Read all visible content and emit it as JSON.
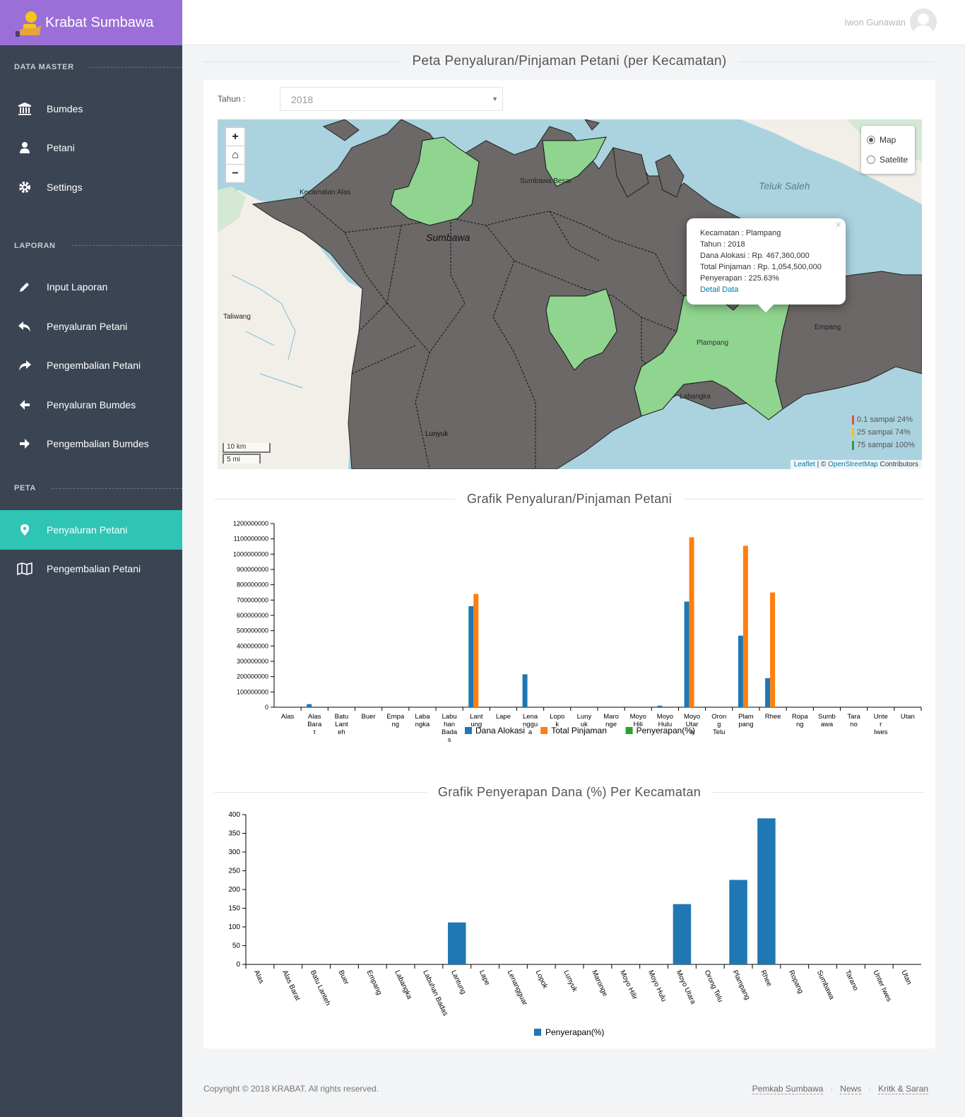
{
  "brand": {
    "title": "Krabat Sumbawa"
  },
  "sidebar": {
    "sections": [
      {
        "title": "DATA MASTER"
      },
      {
        "title": "LAPORAN"
      },
      {
        "title": "PETA"
      }
    ],
    "items": [
      {
        "label": "Bumdes",
        "icon": "bank-icon"
      },
      {
        "label": "Petani",
        "icon": "user-icon"
      },
      {
        "label": "Settings",
        "icon": "gear-icon"
      },
      {
        "label": "Input Laporan",
        "icon": "pencil-icon"
      },
      {
        "label": "Penyaluran Petani",
        "icon": "reply-icon"
      },
      {
        "label": "Pengembalian Petani",
        "icon": "share-icon"
      },
      {
        "label": "Penyaluran Bumdes",
        "icon": "arrow-left-icon"
      },
      {
        "label": "Pengembalian Bumdes",
        "icon": "arrow-right-icon"
      },
      {
        "label": "Penyaluran Petani",
        "icon": "map-marker-icon",
        "active": true
      },
      {
        "label": "Pengembalian Petani",
        "icon": "map-icon"
      }
    ]
  },
  "header": {
    "user_name": "Iwon Gunawan"
  },
  "page": {
    "title": "Peta Penyaluran/Pinjaman Petani (per Kecamatan)",
    "tahun_label": "Tahun :",
    "tahun_value": "2018"
  },
  "map": {
    "zoom_in": "+",
    "home": "⌂",
    "zoom_out": "−",
    "layers": [
      {
        "label": "Map",
        "selected": true
      },
      {
        "label": "Satelite",
        "selected": false
      }
    ],
    "place_labels": [
      "Kecamatan Alas",
      "Sumbawa",
      "Sumbawa Besar",
      "Teluk Saleh",
      "Taliwang",
      "Plampang",
      "Empang",
      "Labangka",
      "Lunyuk"
    ],
    "popup": {
      "lines": [
        "Kecamatan : Plampang",
        "Tahun : 2018",
        "Dana Alokasi : Rp. 467,360,000",
        "Total Pinjaman : Rp. 1,054,500,000",
        "Penyerapan : 225.63%"
      ],
      "link": "Detail Data",
      "close": "×"
    },
    "legend": [
      {
        "label": "0.1 sampai 24%",
        "color": "#d9534f"
      },
      {
        "label": "25 sampai 74%",
        "color": "#f0c419"
      },
      {
        "label": "75 sampai 100%",
        "color": "#3a9b3a"
      }
    ],
    "scale": {
      "km": "10 km",
      "mi": "5 mi"
    },
    "attribution": {
      "leaflet": "Leaflet",
      "sep": " | © ",
      "osm": "OpenStreetMap",
      "rest": " Contributors"
    },
    "colors": {
      "sea": "#aad3df",
      "land": "#f2efe9",
      "region": "#6b6867",
      "highlight": "#8fd48f"
    }
  },
  "chart_data": [
    {
      "type": "bar",
      "title": "Grafik Penyaluran/Pinjaman Petani",
      "categories": [
        "Alas",
        "Alas Barat",
        "Batu Lanteh",
        "Buer",
        "Empang",
        "Labangka",
        "Labuhan Badas",
        "Lantung",
        "Lape",
        "Lenangguar",
        "Lopok",
        "Lunyuk",
        "Maronge",
        "Moyo Hilir",
        "Moyo Hulu",
        "Moyo Utara",
        "Orong Telu",
        "Plampang",
        "Rhee",
        "Ropang",
        "Sumbawa",
        "Tarano",
        "Unter Iwes",
        "Utan"
      ],
      "tick_labels": [
        "Alas",
        "Alas Bara t",
        "Batu Lant eh",
        "Buer",
        "Empa ng",
        "Laba ngka",
        "Labu han Bada s",
        "Lant ung",
        "Lape",
        "Lena nggu a",
        "Lopo k",
        "Luny uk",
        "Maro nge",
        "Moyo Hili",
        "Moyo Hulu",
        "Moyo Utar a",
        "Oron g Telu",
        "Plam pang",
        "Rhee",
        "Ropa ng",
        "Sumb awa",
        "Tara no",
        "Unte r Iwes",
        "Utan"
      ],
      "series": [
        {
          "name": "Dana Alokasi",
          "color": "#1f77b4",
          "values": [
            0,
            20000000,
            0,
            0,
            0,
            0,
            0,
            660000000,
            0,
            215000000,
            0,
            0,
            0,
            0,
            10000000,
            690000000,
            0,
            467360000,
            190000000,
            0,
            0,
            0,
            0,
            0
          ]
        },
        {
          "name": "Total Pinjaman",
          "color": "#ff7f0e",
          "values": [
            0,
            0,
            0,
            0,
            0,
            0,
            0,
            740000000,
            0,
            0,
            0,
            0,
            0,
            0,
            0,
            1110000000,
            0,
            1054500000,
            750000000,
            0,
            0,
            0,
            0,
            0
          ]
        },
        {
          "name": "Penyerapan(%)",
          "color": "#2ca02c",
          "values": [
            0,
            0,
            0,
            0,
            0,
            0,
            0,
            0,
            0,
            0,
            0,
            0,
            0,
            0,
            0,
            0,
            0,
            0,
            0,
            0,
            0,
            0,
            0,
            0
          ]
        }
      ],
      "ylim": [
        0,
        1200000000
      ],
      "yticks": [
        "0",
        "100000000",
        "200000000",
        "300000000",
        "400000000",
        "500000000",
        "600000000",
        "700000000",
        "800000000",
        "900000000",
        "1000000000",
        "1100000000",
        "1200000000"
      ],
      "legend_placement": "bottom"
    },
    {
      "type": "bar",
      "title": "Grafik Penyerapan Dana (%) Per Kecamatan",
      "categories": [
        "Alas",
        "Alas Barat",
        "Batu Lanteh",
        "Buer",
        "Empang",
        "Labangka",
        "Labuhan Badas",
        "Lantung",
        "Lape",
        "Lenangguar",
        "Lopok",
        "Lunyuk",
        "Maronge",
        "Moyo Hilir",
        "Moyo Hulu",
        "Moyo Utara",
        "Orong Telu",
        "Plampang",
        "Rhee",
        "Ropang",
        "Sumbawa",
        "Tarano",
        "Unter Iwes",
        "Utan"
      ],
      "series": [
        {
          "name": "Penyerapan(%)",
          "color": "#1f77b4",
          "values": [
            0,
            0,
            0,
            0,
            0,
            0,
            0,
            112,
            0,
            0,
            0,
            0,
            0,
            0,
            0,
            161,
            0,
            225.63,
            390,
            0,
            0,
            0,
            0,
            0
          ]
        }
      ],
      "ylim": [
        0,
        400
      ],
      "yticks": [
        "0",
        "50",
        "100",
        "150",
        "200",
        "250",
        "300",
        "350",
        "400"
      ],
      "legend_placement": "bottom"
    }
  ],
  "footer": {
    "copyright": "Copyright © 2018 KRABAT. All rights reserved.",
    "links": [
      "Pemkab Sumbawa",
      "News",
      "Kritk & Saran"
    ],
    "separator": "·"
  }
}
